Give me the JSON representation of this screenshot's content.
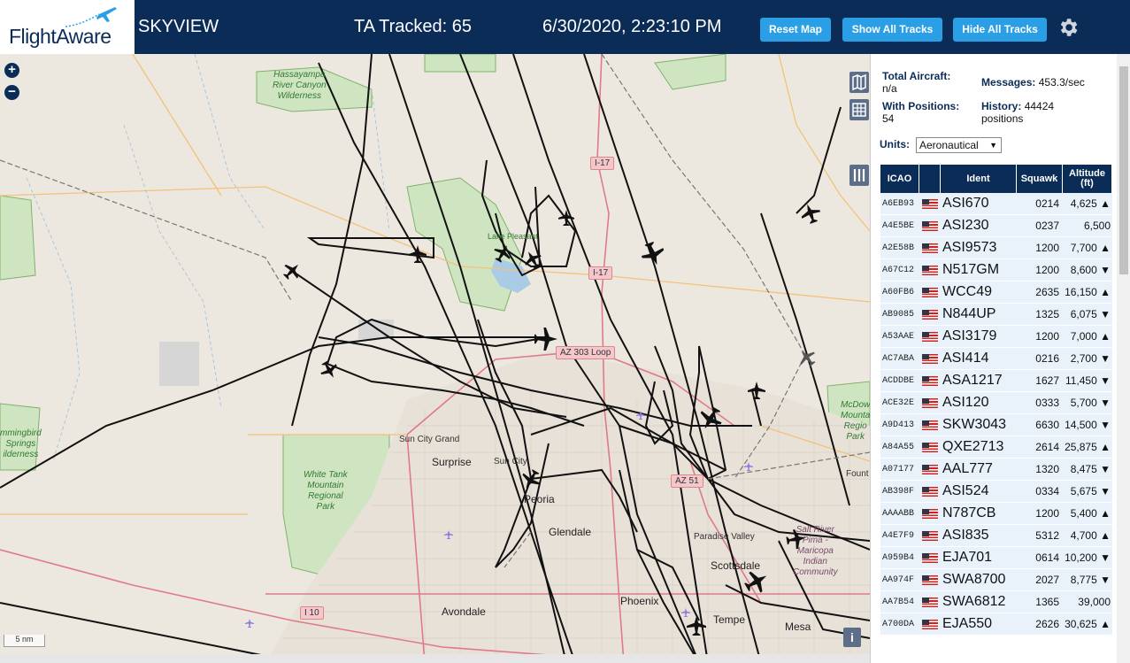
{
  "header": {
    "logo_text": "FlightAware",
    "app_name": "SKYVIEW",
    "tracked": "TA Tracked: 65",
    "clock": "6/30/2020, 2:23:10 PM",
    "buttons": {
      "reset": "Reset Map",
      "show": "Show All Tracks",
      "hide": "Hide All Tracks"
    }
  },
  "map": {
    "zoom_in": "+",
    "zoom_out": "−",
    "scale": "5 nm",
    "info": "i",
    "labels": {
      "hassayampa": "Hassayampa\nRiver Canyon\nWilderness",
      "white_tank": "White Tank\nMountain\nRegional\nPark",
      "hummingbird": "mmingbird\nSprings\nilderness",
      "mcdowell": "McDow\nMounta\nRegio\nPark",
      "salt_river": "Salt River\nPima -\nMaricopa\nIndian\nCommunity",
      "sun_city_grand": "Sun City Grand",
      "surprise": "Surprise",
      "sun_city": "Sun City",
      "peoria": "Peoria",
      "glendale": "Glendale",
      "paradise_valley": "Paradise Valley",
      "scottsdale": "Scottsdale",
      "phoenix": "Phoenix",
      "avondale": "Avondale",
      "tempe": "Tempe",
      "mesa": "Mesa",
      "fount": "Fount",
      "lake": "Lake Pleasant"
    },
    "shields": {
      "i17a": "I-17",
      "i17b": "I-17",
      "az303": "AZ 303 Loop",
      "az51": "AZ 51",
      "i10": "I 10"
    }
  },
  "stats": {
    "total_label": "Total Aircraft:",
    "total_value": "n/a",
    "positions_label": "With Positions:",
    "positions_value": "54",
    "messages_label": "Messages:",
    "messages_value": "453.3/sec",
    "history_label": "History:",
    "history_value": "44424 positions",
    "units_label": "Units:",
    "units_value": "Aeronautical"
  },
  "table": {
    "headers": {
      "icao": "ICAO",
      "ident": "Ident",
      "squawk": "Squawk",
      "altitude": "Altitude (ft)"
    },
    "rows": [
      {
        "icao": "A6EB93",
        "ident": "ASI670",
        "squawk": "0214",
        "alt": "4,625 ▲"
      },
      {
        "icao": "A4E5BE",
        "ident": "ASI230",
        "squawk": "0237",
        "alt": "6,500"
      },
      {
        "icao": "A2E58B",
        "ident": "ASI9573",
        "squawk": "1200",
        "alt": "7,700 ▲"
      },
      {
        "icao": "A67C12",
        "ident": "N517GM",
        "squawk": "1200",
        "alt": "8,600 ▼"
      },
      {
        "icao": "A60FB6",
        "ident": "WCC49",
        "squawk": "2635",
        "alt": "16,150 ▲"
      },
      {
        "icao": "AB9085",
        "ident": "N844UP",
        "squawk": "1325",
        "alt": "6,075 ▼"
      },
      {
        "icao": "A53AAE",
        "ident": "ASI3179",
        "squawk": "1200",
        "alt": "7,000 ▲"
      },
      {
        "icao": "AC7ABA",
        "ident": "ASI414",
        "squawk": "0216",
        "alt": "2,700 ▼"
      },
      {
        "icao": "ACDDBE",
        "ident": "ASA1217",
        "squawk": "1627",
        "alt": "11,450 ▼"
      },
      {
        "icao": "ACE32E",
        "ident": "ASI120",
        "squawk": "0333",
        "alt": "5,700 ▼"
      },
      {
        "icao": "A9D413",
        "ident": "SKW3043",
        "squawk": "6630",
        "alt": "14,500 ▼"
      },
      {
        "icao": "A84A55",
        "ident": "QXE2713",
        "squawk": "2614",
        "alt": "25,875 ▲"
      },
      {
        "icao": "A07177",
        "ident": "AAL777",
        "squawk": "1320",
        "alt": "8,475 ▼"
      },
      {
        "icao": "AB398F",
        "ident": "ASI524",
        "squawk": "0334",
        "alt": "5,675 ▼"
      },
      {
        "icao": "AAAABB",
        "ident": "N787CB",
        "squawk": "1200",
        "alt": "5,400 ▲"
      },
      {
        "icao": "A4E7F9",
        "ident": "ASI835",
        "squawk": "5312",
        "alt": "4,700 ▲"
      },
      {
        "icao": "A959B4",
        "ident": "EJA701",
        "squawk": "0614",
        "alt": "10,200 ▼"
      },
      {
        "icao": "AA974F",
        "ident": "SWA8700",
        "squawk": "2027",
        "alt": "8,775 ▼"
      },
      {
        "icao": "AA7B54",
        "ident": "SWA6812",
        "squawk": "1365",
        "alt": "39,000"
      },
      {
        "icao": "A700DA",
        "ident": "EJA550",
        "squawk": "2626",
        "alt": "30,625 ▲"
      }
    ]
  },
  "colors": {
    "header_bg": "#0b2c57",
    "button_bg": "#2a9fe5",
    "table_row": "#e9f2fb"
  }
}
